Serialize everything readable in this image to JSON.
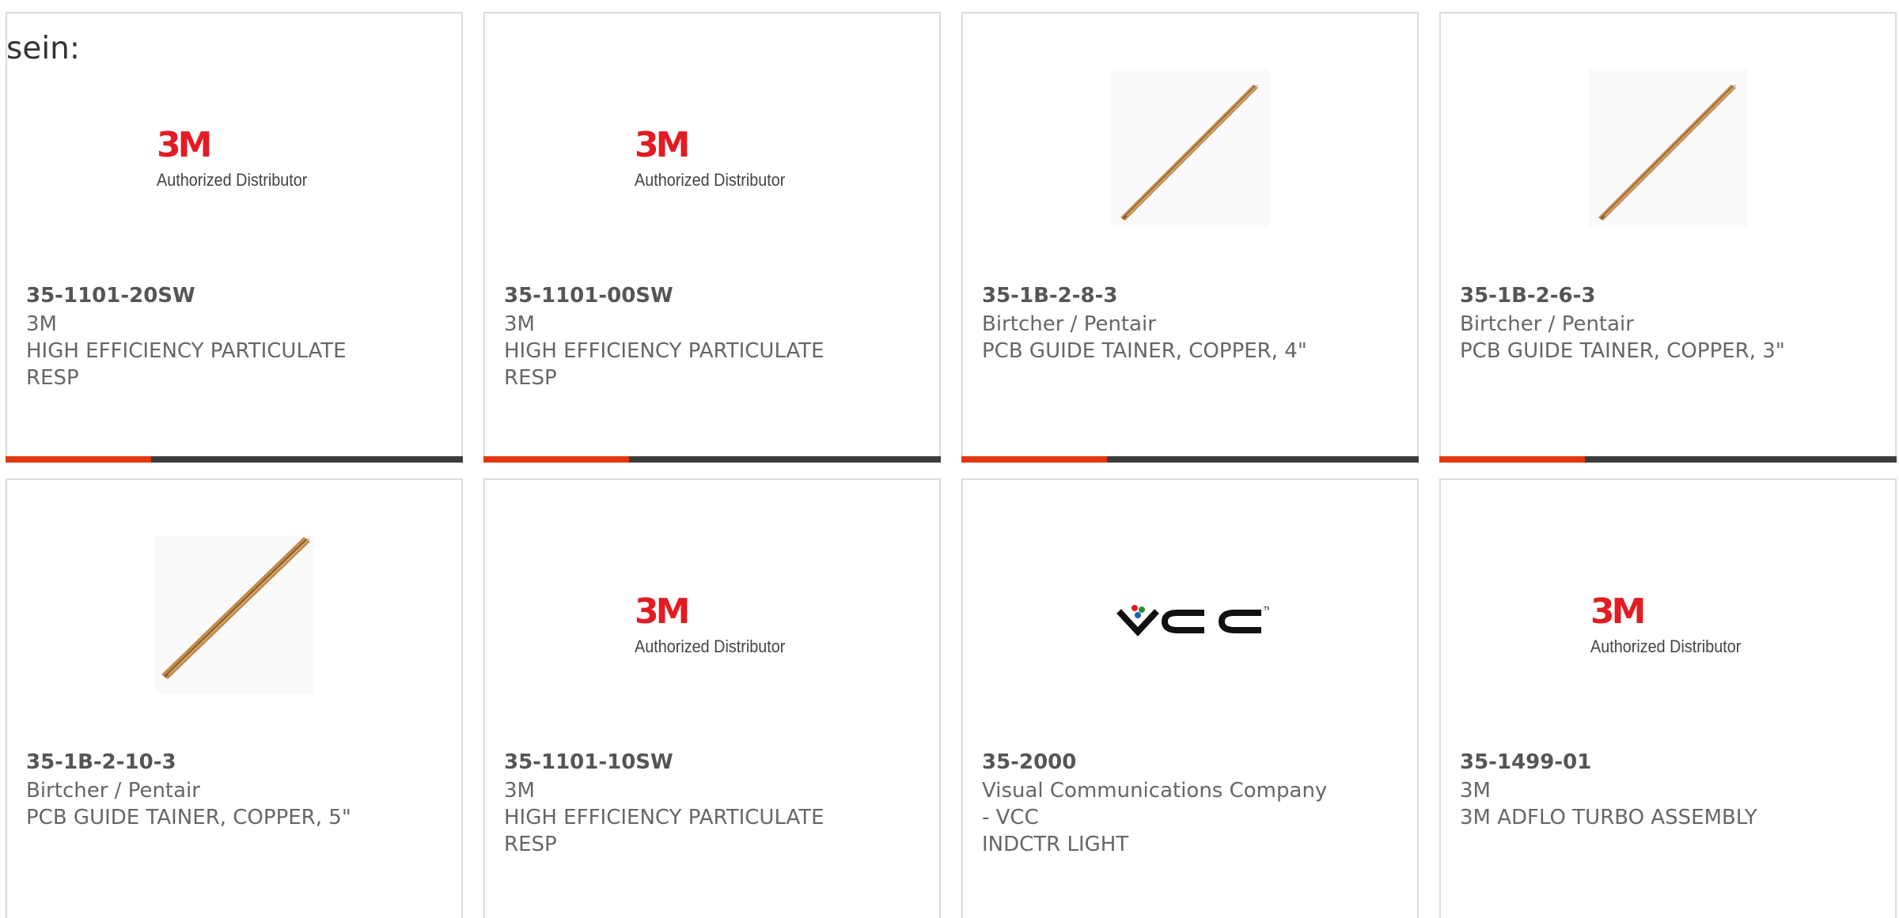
{
  "lead_text": "sein:",
  "logo_text": {
    "three_m_mark": "3M",
    "three_m_sub": "Authorized Distributor"
  },
  "products": [
    {
      "part_no": "35-1101-20SW",
      "brand": "3M",
      "desc_lines": [
        "HIGH EFFICIENCY PARTICULATE",
        "RESP"
      ],
      "image_icon": "3m-authorized-distributor-logo"
    },
    {
      "part_no": "35-1101-00SW",
      "brand": "3M",
      "desc_lines": [
        "HIGH EFFICIENCY PARTICULATE",
        "RESP"
      ],
      "image_icon": "3m-authorized-distributor-logo"
    },
    {
      "part_no": "35-1B-2-8-3",
      "brand": "Birtcher / Pentair",
      "desc_lines": [
        "PCB GUIDE TAINER, COPPER, 4\""
      ],
      "image_icon": "copper-guide-rail-image"
    },
    {
      "part_no": "35-1B-2-6-3",
      "brand": "Birtcher / Pentair",
      "desc_lines": [
        "PCB GUIDE TAINER, COPPER, 3\""
      ],
      "image_icon": "copper-guide-rail-image"
    },
    {
      "part_no": "35-1B-2-10-3",
      "brand": "Birtcher / Pentair",
      "desc_lines": [
        "PCB GUIDE TAINER, COPPER, 5\""
      ],
      "image_icon": "copper-guide-rail-image"
    },
    {
      "part_no": "35-1101-10SW",
      "brand": "3M",
      "desc_lines": [
        "HIGH EFFICIENCY PARTICULATE",
        "RESP"
      ],
      "image_icon": "3m-authorized-distributor-logo"
    },
    {
      "part_no": "35-2000",
      "brand_lines": [
        "Visual Communications Company",
        "- VCC"
      ],
      "desc_lines": [
        "INDCTR LIGHT"
      ],
      "image_icon": "vcc-logo"
    },
    {
      "part_no": "35-1499-01",
      "brand": "3M",
      "desc_lines": [
        "3M ADFLO TURBO ASSEMBLY"
      ],
      "image_icon": "3m-authorized-distributor-logo"
    }
  ],
  "colors": {
    "accent": "#e2380f",
    "bar_dark": "#3d3d3d",
    "card_border": "#dcdcdc",
    "brand_red": "#e31b23",
    "copper": "#b07a3e"
  }
}
